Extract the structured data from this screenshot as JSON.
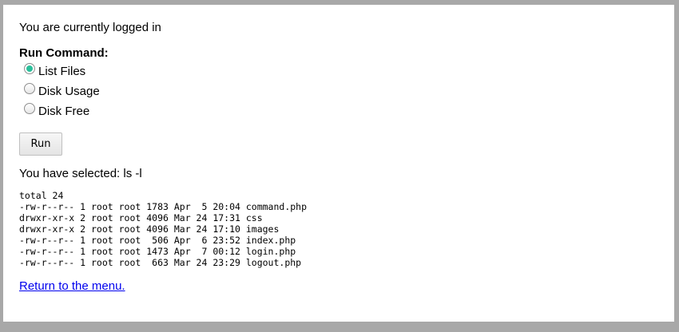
{
  "status_text": "You are currently logged in",
  "form": {
    "label": "Run Command:",
    "options": [
      {
        "label": "List Files",
        "selected": true
      },
      {
        "label": "Disk Usage",
        "selected": false
      },
      {
        "label": "Disk Free",
        "selected": false
      }
    ],
    "run_button": "Run"
  },
  "selected_text": "You have selected: ls -l",
  "output_lines": [
    "total 24",
    "-rw-r--r-- 1 root root 1783 Apr  5 20:04 command.php",
    "drwxr-xr-x 2 root root 4096 Mar 24 17:31 css",
    "drwxr-xr-x 2 root root 4096 Mar 24 17:10 images",
    "-rw-r--r-- 1 root root  506 Apr  6 23:52 index.php",
    "-rw-r--r-- 1 root root 1473 Apr  7 00:12 login.php",
    "-rw-r--r-- 1 root root  663 Mar 24 23:29 logout.php"
  ],
  "return_link": "Return to the menu.",
  "colors": {
    "accent": "#2bbf9b",
    "link": "#0000ee"
  }
}
